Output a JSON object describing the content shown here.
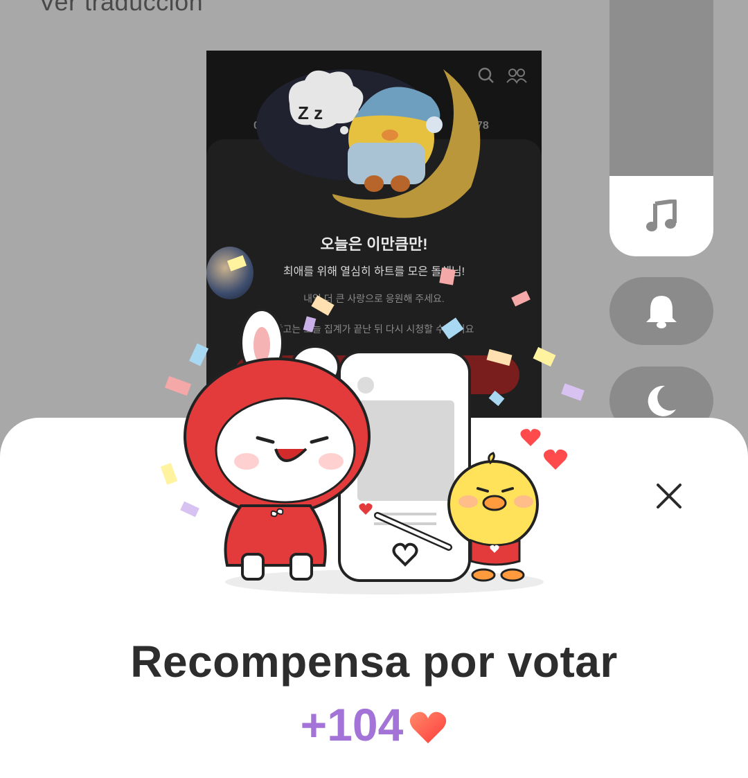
{
  "background": {
    "top_text": "Ver traducción"
  },
  "dark_card": {
    "title": "오늘은 이만큼만!",
    "line1": "최애를 위해 열심히 하트를 모은 돌체님!",
    "line2": "내일 더 큰 사랑으로 응원해 주세요.",
    "line3": "광고는 오늘 집계가 끝난 뒤 다시 시청할 수 있어요",
    "left_number": "0",
    "right_number": "78",
    "header_icons": [
      "search-icon",
      "people-icon"
    ]
  },
  "side_panel": {
    "buttons": [
      "music-note-icon",
      "bell-icon",
      "moon-icon"
    ]
  },
  "sheet": {
    "close_icon": "close-icon",
    "title": "Recompensa por votar",
    "amount": "+104",
    "amount_icon": "heart-icon"
  },
  "colors": {
    "accent_purple": "#a373d8",
    "heart_red": "#ff5a5a",
    "bunny_red": "#e33b3b",
    "chick_yellow": "#ffe15a"
  }
}
